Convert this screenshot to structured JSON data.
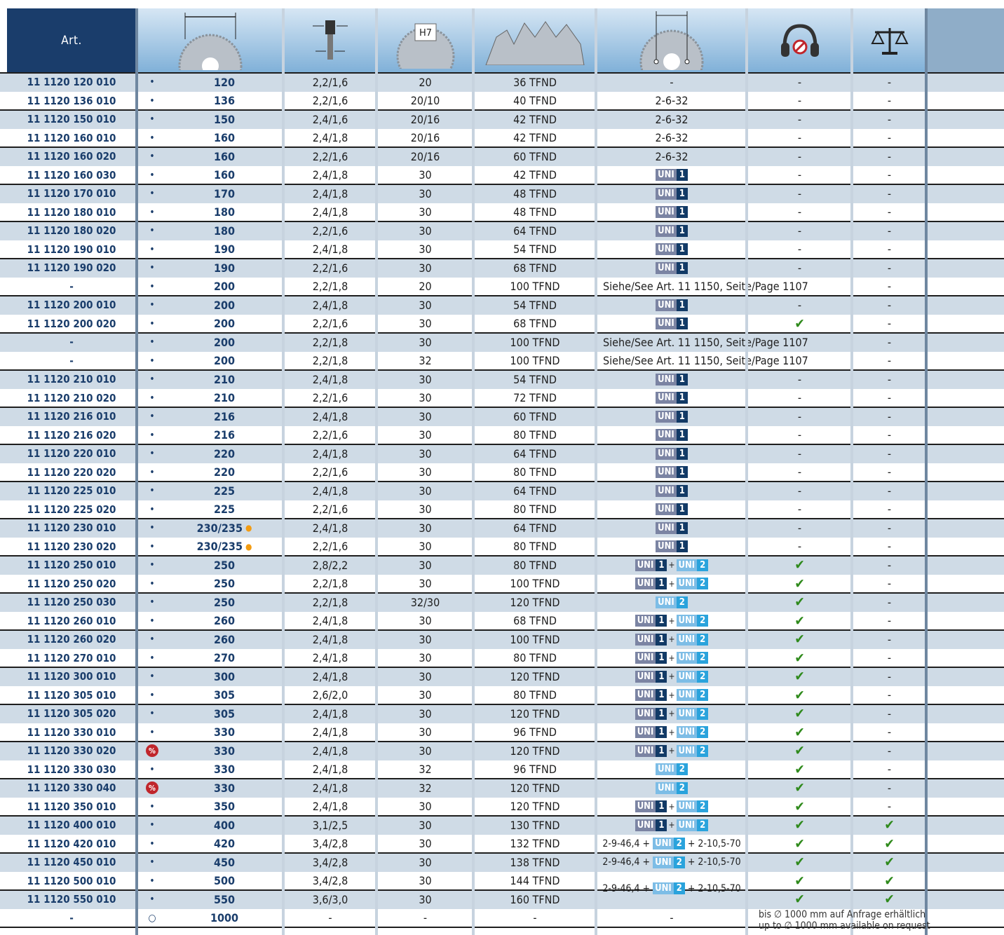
{
  "header": {
    "art_label": "Art.",
    "hole_label": "H7"
  },
  "icons": {
    "diameter": "saw-diameter-icon",
    "kerf": "kerf-width-icon",
    "bore": "bore-hole-icon",
    "teeth": "tooth-shape-icon",
    "pinholes": "pinhole-icon",
    "noise": "noise-reduction-icon",
    "weight": "balance-scale-icon"
  },
  "colors": {
    "header_blue": "#1a3d6b",
    "row_shade": "#cfdbe6",
    "check_green": "#2f8a1c",
    "uni1": "#123a66",
    "uni2": "#2aa3dc",
    "promo_red": "#c0262c",
    "dot_orange": "#f39c12"
  },
  "uni_text": {
    "u": "UNI",
    "one": "1",
    "two": "2",
    "plus": "+"
  },
  "rows": [
    {
      "art": "11 1120 120 010",
      "avail": "•",
      "dia": "120",
      "kerf": "2,2/1,6",
      "bore": "20",
      "teeth": "36 TFND",
      "pin": "-",
      "noise": "-",
      "weight": "-"
    },
    {
      "art": "11 1120 136 010",
      "avail": "•",
      "dia": "136",
      "kerf": "2,2/1,6",
      "bore": "20/10",
      "teeth": "40 TFND",
      "pin": "2-6-32",
      "noise": "-",
      "weight": "-"
    },
    {
      "art": "11 1120 150 010",
      "avail": "•",
      "dia": "150",
      "kerf": "2,4/1,6",
      "bore": "20/16",
      "teeth": "42 TFND",
      "pin": "2-6-32",
      "noise": "-",
      "weight": "-"
    },
    {
      "art": "11 1120 160 010",
      "avail": "•",
      "dia": "160",
      "kerf": "2,4/1,8",
      "bore": "20/16",
      "teeth": "42 TFND",
      "pin": "2-6-32",
      "noise": "-",
      "weight": "-"
    },
    {
      "art": "11 1120 160 020",
      "avail": "•",
      "dia": "160",
      "kerf": "2,2/1,6",
      "bore": "20/16",
      "teeth": "60 TFND",
      "pin": "2-6-32",
      "noise": "-",
      "weight": "-"
    },
    {
      "art": "11 1120 160 030",
      "avail": "•",
      "dia": "160",
      "kerf": "2,4/1,8",
      "bore": "30",
      "teeth": "42 TFND",
      "pin": "uni1",
      "noise": "-",
      "weight": "-"
    },
    {
      "art": "11 1120 170 010",
      "avail": "•",
      "dia": "170",
      "kerf": "2,4/1,8",
      "bore": "30",
      "teeth": "48 TFND",
      "pin": "uni1",
      "noise": "-",
      "weight": "-"
    },
    {
      "art": "11 1120 180 010",
      "avail": "•",
      "dia": "180",
      "kerf": "2,4/1,8",
      "bore": "30",
      "teeth": "48 TFND",
      "pin": "uni1",
      "noise": "-",
      "weight": "-"
    },
    {
      "art": "11 1120 180 020",
      "avail": "•",
      "dia": "180",
      "kerf": "2,2/1,6",
      "bore": "30",
      "teeth": "64 TFND",
      "pin": "uni1",
      "noise": "-",
      "weight": "-"
    },
    {
      "art": "11 1120 190 010",
      "avail": "•",
      "dia": "190",
      "kerf": "2,4/1,8",
      "bore": "30",
      "teeth": "54 TFND",
      "pin": "uni1",
      "noise": "-",
      "weight": "-"
    },
    {
      "art": "11 1120 190 020",
      "avail": "•",
      "dia": "190",
      "kerf": "2,2/1,6",
      "bore": "30",
      "teeth": "68 TFND",
      "pin": "uni1",
      "noise": "-",
      "weight": "-"
    },
    {
      "art": "-",
      "avail": "•",
      "dia": "200",
      "kerf": "2,2/1,8",
      "bore": "20",
      "teeth": "100 TFND",
      "pin": "Siehe/See Art. 11 1150, Seite/Page 1107",
      "noise": "",
      "weight": "-"
    },
    {
      "art": "11 1120 200 010",
      "avail": "•",
      "dia": "200",
      "kerf": "2,4/1,8",
      "bore": "30",
      "teeth": "54 TFND",
      "pin": "uni1",
      "noise": "-",
      "weight": "-"
    },
    {
      "art": "11 1120 200 020",
      "avail": "•",
      "dia": "200",
      "kerf": "2,2/1,6",
      "bore": "30",
      "teeth": "68 TFND",
      "pin": "uni1",
      "noise": "✔",
      "weight": "-"
    },
    {
      "art": "-",
      "avail": "•",
      "dia": "200",
      "kerf": "2,2/1,8",
      "bore": "30",
      "teeth": "100 TFND",
      "pin": "Siehe/See Art. 11 1150, Seite/Page 1107",
      "noise": "",
      "weight": "-"
    },
    {
      "art": "-",
      "avail": "•",
      "dia": "200",
      "kerf": "2,2/1,8",
      "bore": "32",
      "teeth": "100 TFND",
      "pin": "Siehe/See Art. 11 1150, Seite/Page 1107",
      "noise": "",
      "weight": "-"
    },
    {
      "art": "11 1120 210 010",
      "avail": "•",
      "dia": "210",
      "kerf": "2,4/1,8",
      "bore": "30",
      "teeth": "54 TFND",
      "pin": "uni1",
      "noise": "-",
      "weight": "-"
    },
    {
      "art": "11 1120 210 020",
      "avail": "•",
      "dia": "210",
      "kerf": "2,2/1,6",
      "bore": "30",
      "teeth": "72 TFND",
      "pin": "uni1",
      "noise": "-",
      "weight": "-"
    },
    {
      "art": "11 1120 216 010",
      "avail": "•",
      "dia": "216",
      "kerf": "2,4/1,8",
      "bore": "30",
      "teeth": "60 TFND",
      "pin": "uni1",
      "noise": "-",
      "weight": "-"
    },
    {
      "art": "11 1120 216 020",
      "avail": "•",
      "dia": "216",
      "kerf": "2,2/1,6",
      "bore": "30",
      "teeth": "80 TFND",
      "pin": "uni1",
      "noise": "-",
      "weight": "-"
    },
    {
      "art": "11 1120 220 010",
      "avail": "•",
      "dia": "220",
      "kerf": "2,4/1,8",
      "bore": "30",
      "teeth": "64 TFND",
      "pin": "uni1",
      "noise": "-",
      "weight": "-"
    },
    {
      "art": "11 1120 220 020",
      "avail": "•",
      "dia": "220",
      "kerf": "2,2/1,6",
      "bore": "30",
      "teeth": "80 TFND",
      "pin": "uni1",
      "noise": "-",
      "weight": "-"
    },
    {
      "art": "11 1120 225 010",
      "avail": "•",
      "dia": "225",
      "kerf": "2,4/1,8",
      "bore": "30",
      "teeth": "64 TFND",
      "pin": "uni1",
      "noise": "-",
      "weight": "-"
    },
    {
      "art": "11 1120 225 020",
      "avail": "•",
      "dia": "225",
      "kerf": "2,2/1,6",
      "bore": "30",
      "teeth": "80 TFND",
      "pin": "uni1",
      "noise": "-",
      "weight": "-"
    },
    {
      "art": "11 1120 230 010",
      "avail": "•",
      "dia": "230/235",
      "dot": "●",
      "kerf": "2,4/1,8",
      "bore": "30",
      "teeth": "64 TFND",
      "pin": "uni1",
      "noise": "-",
      "weight": "-"
    },
    {
      "art": "11 1120 230 020",
      "avail": "•",
      "dia": "230/235",
      "dot": "●",
      "kerf": "2,2/1,6",
      "bore": "30",
      "teeth": "80 TFND",
      "pin": "uni1",
      "noise": "-",
      "weight": "-"
    },
    {
      "art": "11 1120 250 010",
      "avail": "•",
      "dia": "250",
      "kerf": "2,8/2,2",
      "bore": "30",
      "teeth": "80 TFND",
      "pin": "uni12",
      "noise": "✔",
      "weight": "-"
    },
    {
      "art": "11 1120 250 020",
      "avail": "•",
      "dia": "250",
      "kerf": "2,2/1,8",
      "bore": "30",
      "teeth": "100 TFND",
      "pin": "uni12",
      "noise": "✔",
      "weight": "-"
    },
    {
      "art": "11 1120 250 030",
      "avail": "•",
      "dia": "250",
      "kerf": "2,2/1,8",
      "bore": "32/30",
      "teeth": "120 TFND",
      "pin": "uni2",
      "noise": "✔",
      "weight": "-"
    },
    {
      "art": "11 1120 260 010",
      "avail": "•",
      "dia": "260",
      "kerf": "2,4/1,8",
      "bore": "30",
      "teeth": "68 TFND",
      "pin": "uni12",
      "noise": "✔",
      "weight": "-"
    },
    {
      "art": "11 1120 260 020",
      "avail": "•",
      "dia": "260",
      "kerf": "2,4/1,8",
      "bore": "30",
      "teeth": "100 TFND",
      "pin": "uni12",
      "noise": "✔",
      "weight": "-"
    },
    {
      "art": "11 1120 270 010",
      "avail": "•",
      "dia": "270",
      "kerf": "2,4/1,8",
      "bore": "30",
      "teeth": "80 TFND",
      "pin": "uni12",
      "noise": "✔",
      "weight": "-"
    },
    {
      "art": "11 1120 300 010",
      "avail": "•",
      "dia": "300",
      "kerf": "2,4/1,8",
      "bore": "30",
      "teeth": "120 TFND",
      "pin": "uni12",
      "noise": "✔",
      "weight": "-"
    },
    {
      "art": "11 1120 305 010",
      "avail": "•",
      "dia": "305",
      "kerf": "2,6/2,0",
      "bore": "30",
      "teeth": "80 TFND",
      "pin": "uni12",
      "noise": "✔",
      "weight": "-"
    },
    {
      "art": "11 1120 305 020",
      "avail": "•",
      "dia": "305",
      "kerf": "2,4/1,8",
      "bore": "30",
      "teeth": "120 TFND",
      "pin": "uni12",
      "noise": "✔",
      "weight": "-"
    },
    {
      "art": "11 1120 330 010",
      "avail": "•",
      "dia": "330",
      "kerf": "2,4/1,8",
      "bore": "30",
      "teeth": "96 TFND",
      "pin": "uni12",
      "noise": "✔",
      "weight": "-"
    },
    {
      "art": "11 1120 330 020",
      "avail": "%",
      "dia": "330",
      "kerf": "2,4/1,8",
      "bore": "30",
      "teeth": "120 TFND",
      "pin": "uni12",
      "noise": "✔",
      "weight": "-"
    },
    {
      "art": "11 1120 330 030",
      "avail": "•",
      "dia": "330",
      "kerf": "2,4/1,8",
      "bore": "32",
      "teeth": "96 TFND",
      "pin": "uni2",
      "noise": "✔",
      "weight": "-"
    },
    {
      "art": "11 1120 330 040",
      "avail": "%",
      "dia": "330",
      "kerf": "2,4/1,8",
      "bore": "32",
      "teeth": "120 TFND",
      "pin": "uni2",
      "noise": "✔",
      "weight": "-"
    },
    {
      "art": "11 1120 350 010",
      "avail": "•",
      "dia": "350",
      "kerf": "2,4/1,8",
      "bore": "30",
      "teeth": "120 TFND",
      "pin": "uni12",
      "noise": "✔",
      "weight": "-"
    },
    {
      "art": "11 1120 400 010",
      "avail": "•",
      "dia": "400",
      "kerf": "3,1/2,5",
      "bore": "30",
      "teeth": "130 TFND",
      "pin": "uni12",
      "noise": "✔",
      "weight": "✔"
    },
    {
      "art": "11 1120 420 010",
      "avail": "•",
      "dia": "420",
      "kerf": "3,4/2,8",
      "bore": "30",
      "teeth": "132 TFND",
      "pin": "mix",
      "noise": "✔",
      "weight": "✔"
    },
    {
      "art": "11 1120 450 010",
      "avail": "•",
      "dia": "450",
      "kerf": "3,4/2,8",
      "bore": "30",
      "teeth": "138 TFND",
      "pin": "mix",
      "noise": "✔",
      "weight": "✔"
    },
    {
      "art": "11 1120 500 010",
      "avail": "•",
      "dia": "500",
      "kerf": "3,4/2,8",
      "bore": "30",
      "teeth": "144 TFND",
      "pin": "",
      "noise": "✔",
      "weight": "✔"
    },
    {
      "art": "11 1120 550 010",
      "avail": "•",
      "dia": "550",
      "kerf": "3,6/3,0",
      "bore": "30",
      "teeth": "160 TFND",
      "pin": "",
      "noise": "✔",
      "weight": "✔"
    },
    {
      "art": "-",
      "avail": "○",
      "dia": "1000",
      "kerf": "-",
      "bore": "-",
      "teeth": "-",
      "pin": "-",
      "noise": "",
      "weight": ""
    }
  ],
  "mix_left": "2-9-46,4 +",
  "mix_right": "+ 2-10,5-70",
  "merged_note": {
    "left": "2-9-46,4 +",
    "right": "+ 2-10,5-70"
  },
  "footnote": {
    "line1": "bis ∅ 1000 mm auf Anfrage erhältlich",
    "line2": "up to ∅ 1000 mm available on request"
  }
}
